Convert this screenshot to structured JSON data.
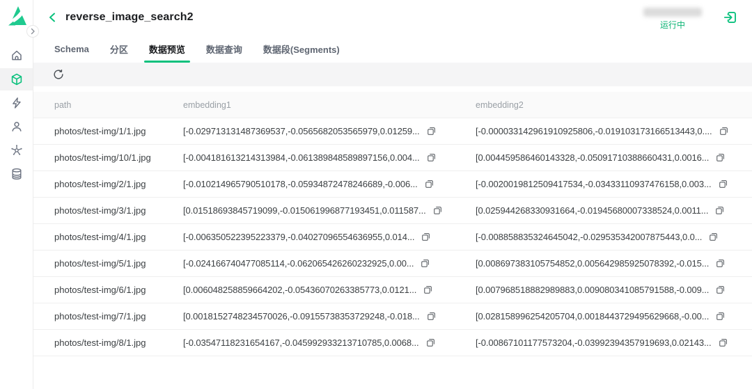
{
  "accent_color": "#0ac17d",
  "sidebar": {
    "logo_icon": "zilliz-logo",
    "collapse_icon": "chevron-right-icon",
    "items": [
      {
        "icon": "home-icon",
        "active": false
      },
      {
        "icon": "cube-icon",
        "active": true
      },
      {
        "icon": "lightning-icon",
        "active": false
      },
      {
        "icon": "user-icon",
        "active": false
      },
      {
        "icon": "cluster-icon",
        "active": false
      },
      {
        "icon": "database-icon",
        "active": false
      }
    ]
  },
  "header": {
    "back_icon": "chevron-left-icon",
    "title": "reverse_image_search2",
    "status_label": "运行中",
    "status_color": "#0ab373",
    "import_icon": "import-icon",
    "redacted_block": true
  },
  "tabs": [
    {
      "label": "Schema",
      "active": false
    },
    {
      "label": "分区",
      "active": false
    },
    {
      "label": "数据预览",
      "active": true
    },
    {
      "label": "数据查询",
      "active": false
    },
    {
      "label": "数据段(Segments)",
      "active": false
    }
  ],
  "toolbar": {
    "refresh_icon": "refresh-icon"
  },
  "table": {
    "columns": [
      "path",
      "embedding1",
      "embedding2"
    ],
    "copy_icon": "copy-icon",
    "rows": [
      {
        "path": "photos/test-img/1/1.jpg",
        "embedding1": "[-0.029713131487369537,-0.0565682053565979,0.01259...",
        "embedding2": "[-0.000033142961910925806,-0.019103173166513443,0...."
      },
      {
        "path": "photos/test-img/10/1.jpg",
        "embedding1": "[-0.004181613214313984,-0.061389848589897156,0.004...",
        "embedding2": "[0.004459586460143328,-0.05091710388660431,0.0016..."
      },
      {
        "path": "photos/test-img/2/1.jpg",
        "embedding1": "[-0.010214965790510178,-0.05934872478246689,-0.006...",
        "embedding2": "[-0.0020019812509417534,-0.03433110937476158,0.003..."
      },
      {
        "path": "photos/test-img/3/1.jpg",
        "embedding1": "[0.01518693845719099,-0.015061996877193451,0.011587...",
        "embedding2": "[0.025944268330931664,-0.01945680007338524,0.0011..."
      },
      {
        "path": "photos/test-img/4/1.jpg",
        "embedding1": "[-0.006350522395223379,-0.04027096554636955,0.014...",
        "embedding2": "[-0.008858835324645042,-0.029535342007875443,0.0..."
      },
      {
        "path": "photos/test-img/5/1.jpg",
        "embedding1": "[-0.024166740477085114,-0.062065426260232925,0.00...",
        "embedding2": "[0.008697383105754852,0.005642985925078392,-0.015..."
      },
      {
        "path": "photos/test-img/6/1.jpg",
        "embedding1": "[0.006048258859664202,-0.05436070263385773,0.0121...",
        "embedding2": "[0.007968518882989883,0.009080341085791588,-0.009..."
      },
      {
        "path": "photos/test-img/7/1.jpg",
        "embedding1": "[0.0018152748234570026,-0.09155738353729248,-0.018...",
        "embedding2": "[0.028158996254205704,0.0018443729495629668,-0.00..."
      },
      {
        "path": "photos/test-img/8/1.jpg",
        "embedding1": "[-0.03547118231654167,-0.045992933213710785,0.0068...",
        "embedding2": "[-0.00867101177573204,-0.03992394357919693,0.02143..."
      }
    ]
  }
}
